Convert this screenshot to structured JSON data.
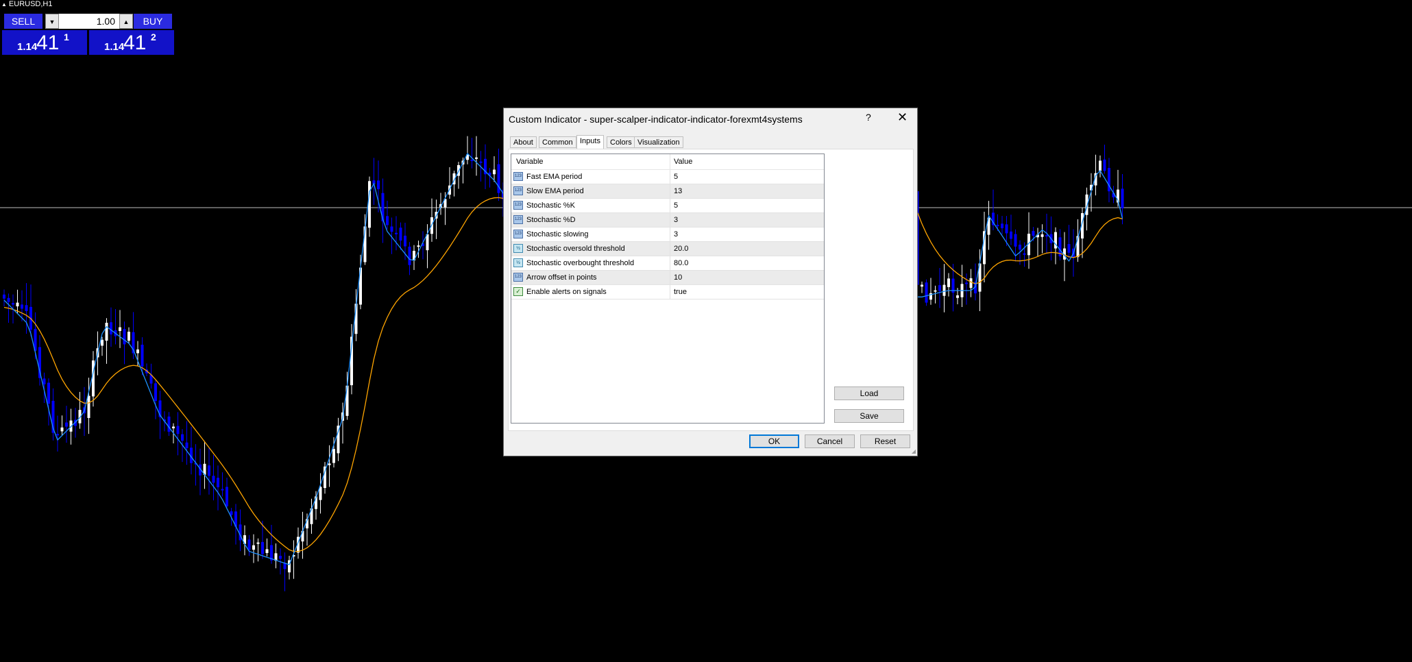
{
  "chart": {
    "symbol": "EURUSD,H1",
    "colors": {
      "background": "#000000",
      "bull": "#ffffff",
      "bear": "#0000ff",
      "fast_ema": "#1e90ff",
      "slow_ema": "#ffa500",
      "crosshair": "#c0c0c0"
    }
  },
  "trade_panel": {
    "sell_label": "SELL",
    "buy_label": "BUY",
    "lot_value": "1.00",
    "sell_price": {
      "prefix": "1.14",
      "big": "41",
      "sup": "1"
    },
    "buy_price": {
      "prefix": "1.14",
      "big": "41",
      "sup": "2"
    }
  },
  "dialog": {
    "title": "Custom Indicator - super-scalper-indicator-indicator-forexmt4systems",
    "help": "?",
    "close": "✕",
    "tabs": [
      {
        "label": "About"
      },
      {
        "label": "Common"
      },
      {
        "label": "Inputs",
        "active": true
      },
      {
        "label": "Colors"
      },
      {
        "label": "Visualization"
      }
    ],
    "grid": {
      "headers": {
        "variable": "Variable",
        "value": "Value"
      },
      "rows": [
        {
          "variable": "Fast EMA period",
          "value": "5",
          "icon": "123"
        },
        {
          "variable": "Slow EMA period",
          "value": "13",
          "icon": "123"
        },
        {
          "variable": "Stochastic %K",
          "value": "5",
          "icon": "123"
        },
        {
          "variable": "Stochastic %D",
          "value": "3",
          "icon": "123"
        },
        {
          "variable": "Stochastic slowing",
          "value": "3",
          "icon": "123"
        },
        {
          "variable": "Stochastic oversold threshold",
          "value": "20.0",
          "icon": "½"
        },
        {
          "variable": "Stochastic overbought threshold",
          "value": "80.0",
          "icon": "½"
        },
        {
          "variable": "Arrow offset in points",
          "value": "10",
          "icon": "123"
        },
        {
          "variable": "Enable alerts on signals",
          "value": "true",
          "icon": "✓"
        }
      ]
    },
    "buttons": {
      "load": "Load",
      "save": "Save",
      "ok": "OK",
      "cancel": "Cancel",
      "reset": "Reset"
    }
  }
}
